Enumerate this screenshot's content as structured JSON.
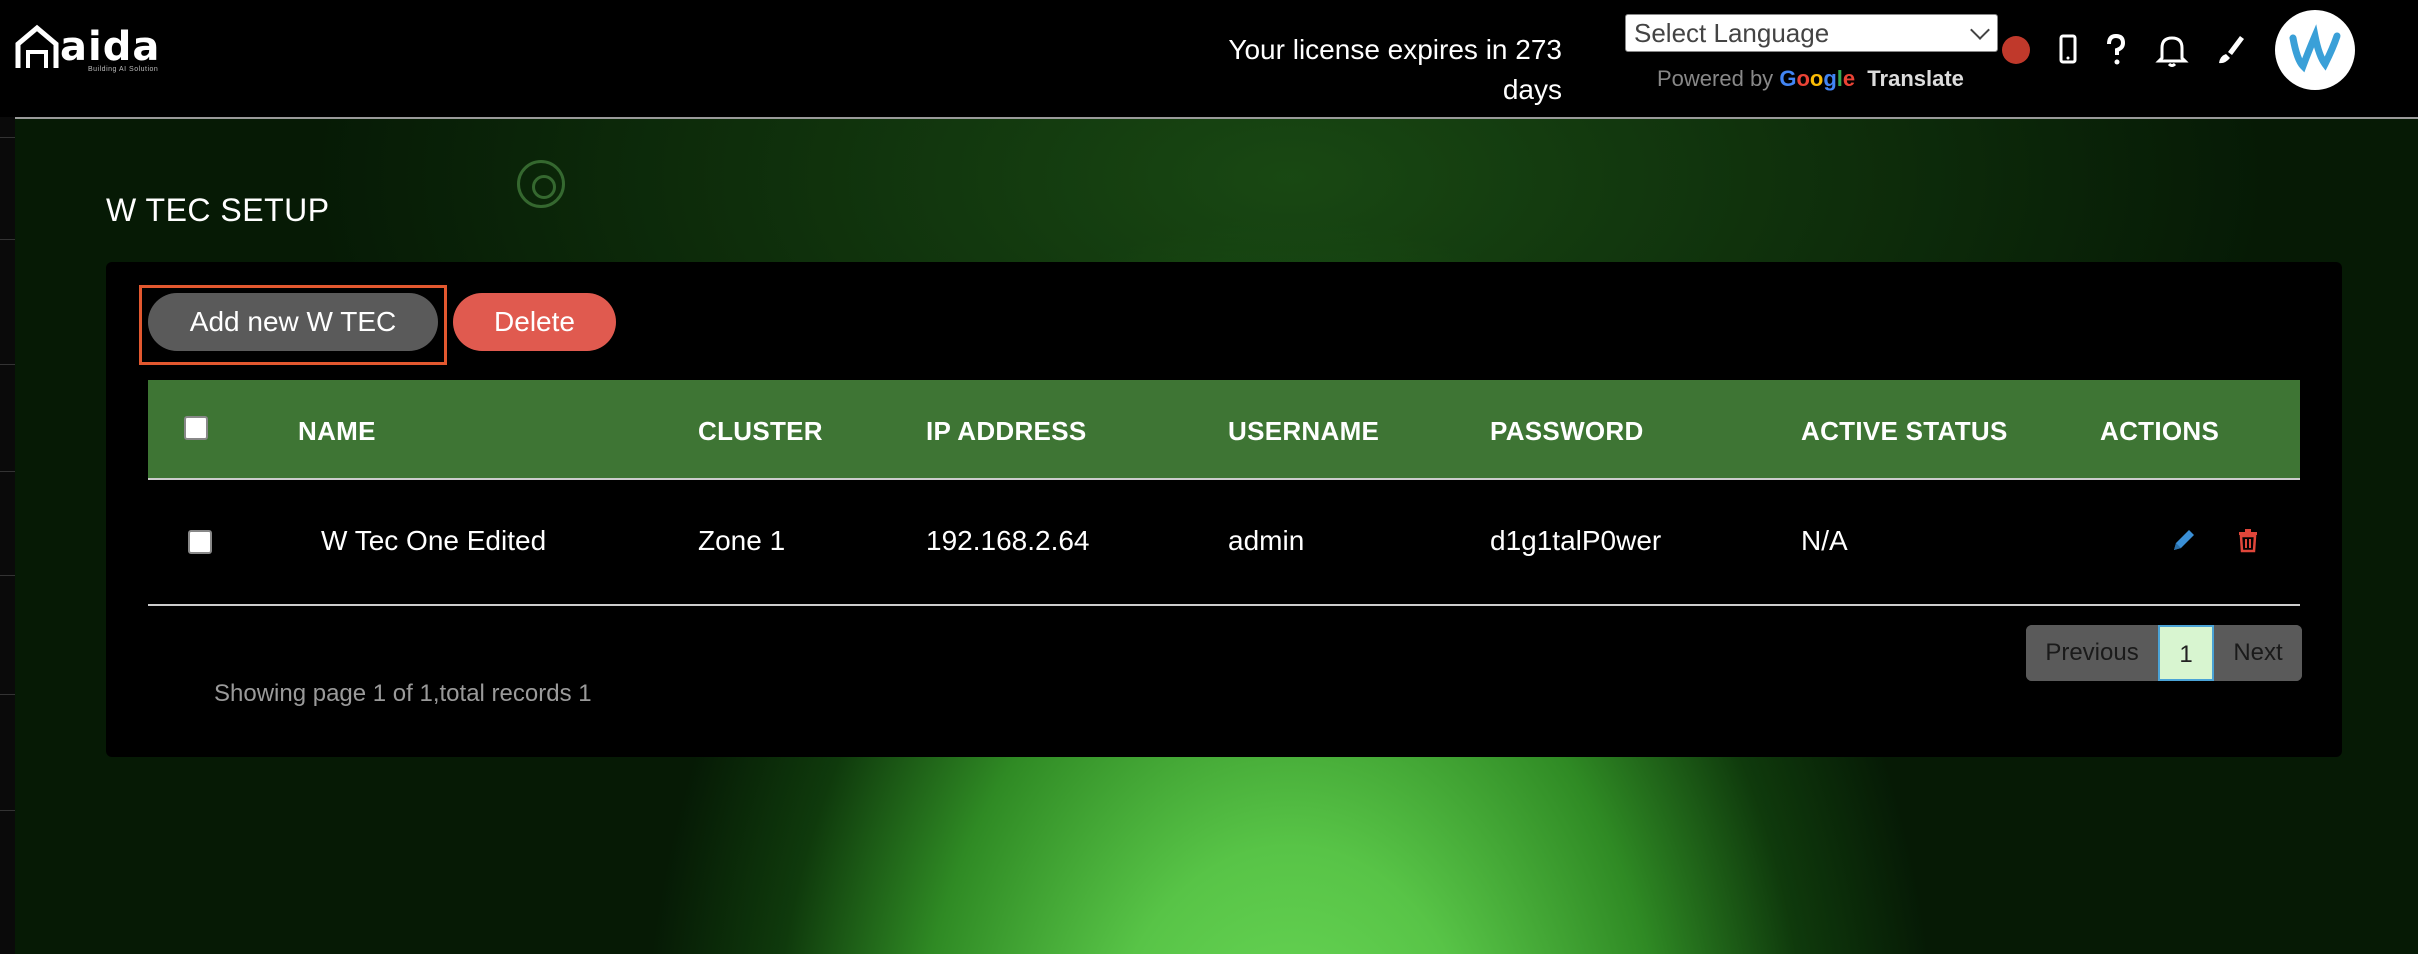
{
  "header": {
    "logo_text": "aida",
    "logo_tagline": "Building AI Solution",
    "license_line1": "Your license expires in 273",
    "license_line2": "days",
    "language_select": "Select Language",
    "powered_by": "Powered by",
    "google": "Google",
    "translate": "Translate",
    "status_color": "#c0392b"
  },
  "page": {
    "title": "W TEC SETUP"
  },
  "toolbar": {
    "add_label": "Add new W TEC",
    "delete_label": "Delete",
    "delete_color": "#e05a4f",
    "table_header_color": "#3e7534"
  },
  "table": {
    "columns": [
      "NAME",
      "CLUSTER",
      "IP ADDRESS",
      "USERNAME",
      "PASSWORD",
      "ACTIVE STATUS",
      "ACTIONS"
    ],
    "rows": [
      {
        "name": "W Tec One Edited",
        "cluster": "Zone 1",
        "ip_address": "192.168.2.64",
        "username": "admin",
        "password": "d1g1talP0wer",
        "active_status": "N/A",
        "actions": [
          "edit-icon",
          "trash-icon"
        ]
      }
    ]
  },
  "pagination": {
    "previous": "Previous",
    "current_page": "1",
    "next": "Next",
    "summary": "Showing page 1 of 1,total records 1"
  },
  "header_icons": [
    "mobile-icon",
    "help-icon",
    "bell-icon",
    "paint-brush-icon"
  ]
}
